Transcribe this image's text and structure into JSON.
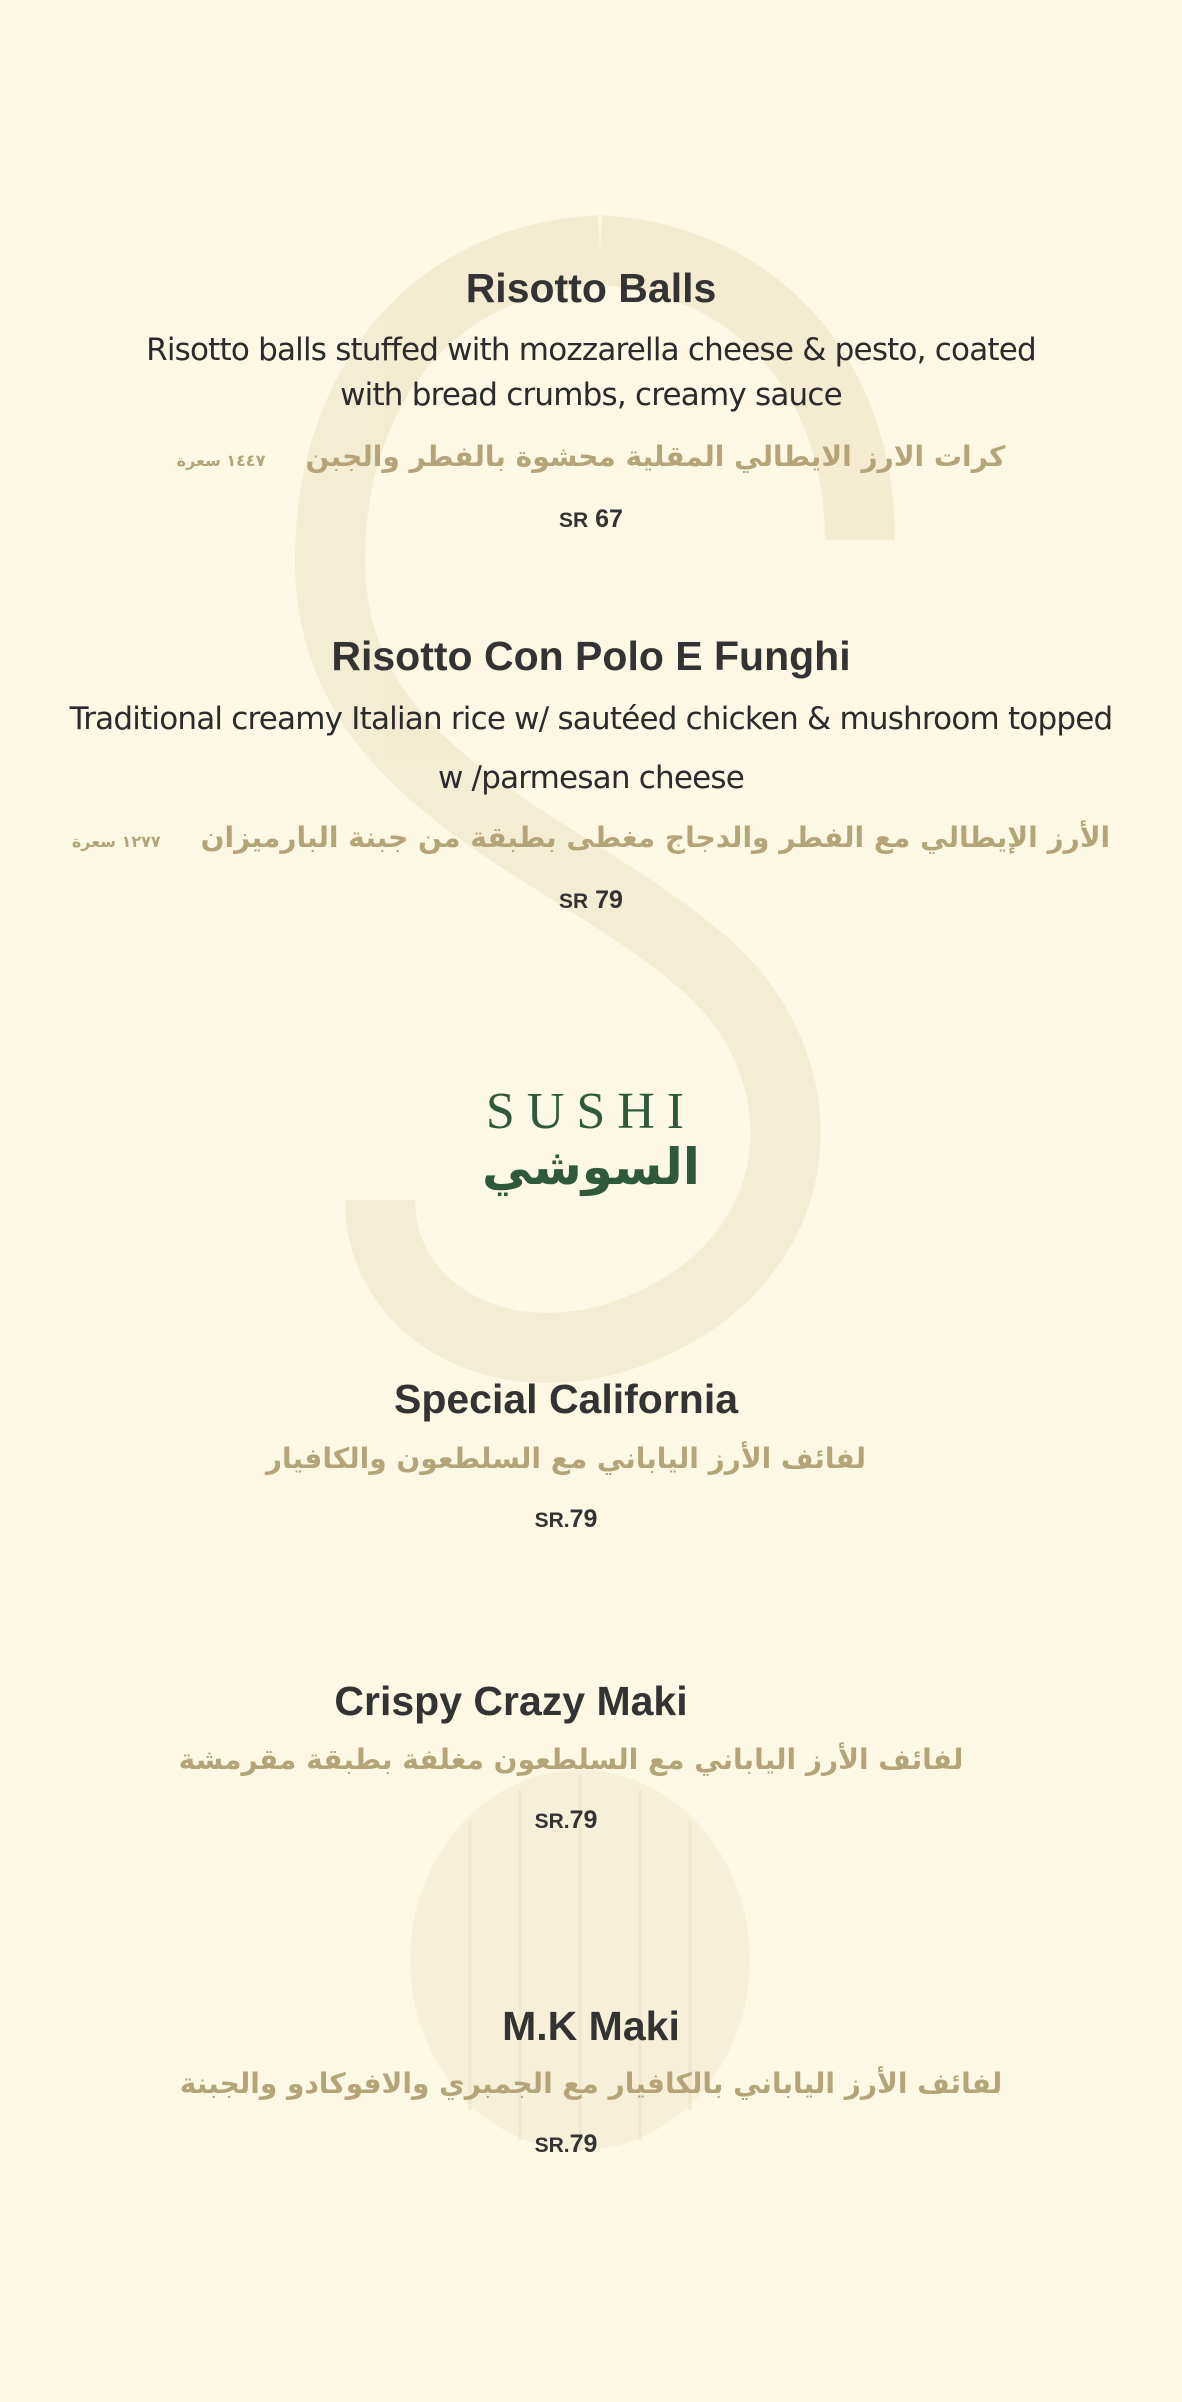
{
  "colors": {
    "background": "#fdf8e4",
    "text": "#333333",
    "arabic_text": "#b5a479",
    "section_heading": "#2e5a3a"
  },
  "items": [
    {
      "name": "Risotto Balls",
      "desc_line1": "Risotto balls stuffed with mozzarella cheese & pesto, coated",
      "desc_line2": "with bread  crumbs, creamy sauce",
      "arabic": "كرات الارز الايطالي المقلية محشوة بالفطر والجبن",
      "calories": "١٤٤٧ سعرة",
      "price_unit": "SR",
      "price": "67"
    },
    {
      "name": "Risotto Con Polo E Funghi",
      "desc_line1": "Traditional creamy Italian rice w/ sautéed chicken & mushroom topped",
      "desc_line2": "w /parmesan cheese",
      "arabic": "الأرز الإيطالي مع الفطر والدجاج مغطى بطبقة من جبنة البارميزان",
      "calories": "١٢٧٧ سعرة",
      "price_unit": "SR",
      "price": "79"
    }
  ],
  "section": {
    "title_en": "SUSHI",
    "title_ar": "السوشي"
  },
  "sushi": [
    {
      "name": "Special California",
      "arabic": "لفائف الأرز الياباني مع السلطعون والكافيار",
      "price_unit": "SR.",
      "price": "79"
    },
    {
      "name": "Crispy Crazy Maki",
      "arabic": "لفائف الأرز الياباني مع السلطعون مغلفة بطبقة مقرمشة",
      "price_unit": "SR.",
      "price": "79"
    },
    {
      "name": "M.K Maki",
      "arabic": "لفائف الأرز الياباني بالكافيار مع الجمبري والافوكادو والجبنة",
      "price_unit": "SR.",
      "price": "79"
    }
  ]
}
